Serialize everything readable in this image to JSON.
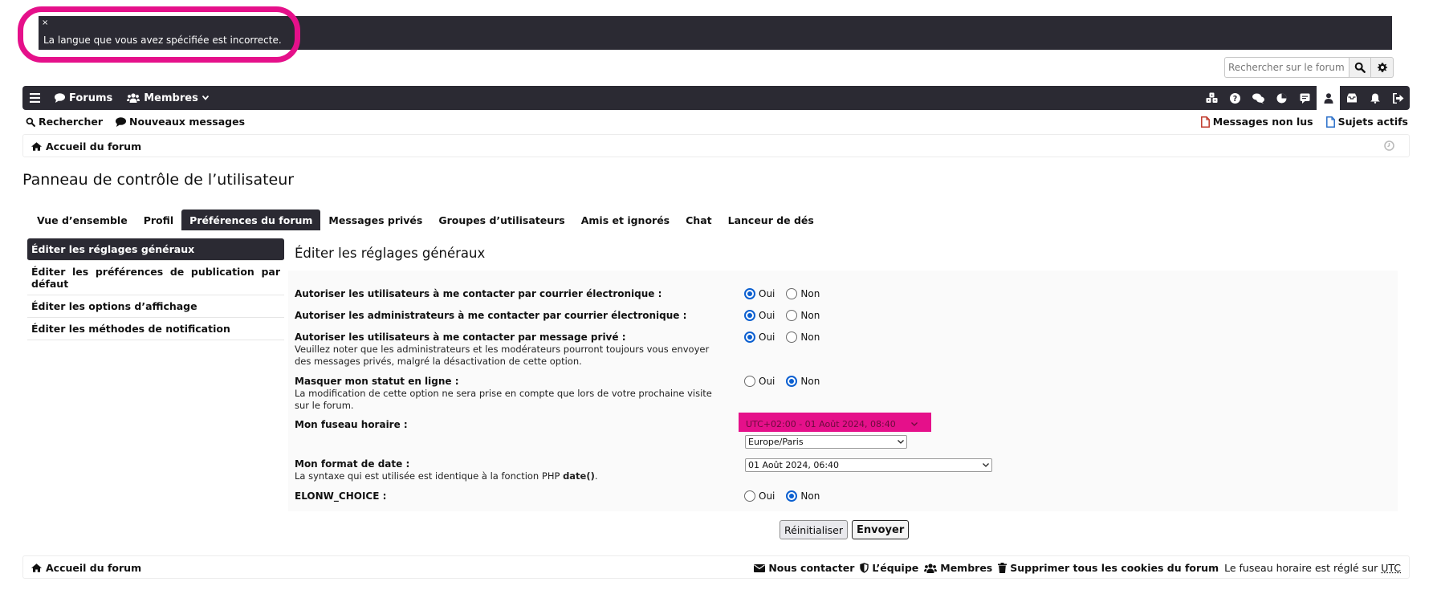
{
  "error_banner": {
    "close": "×",
    "message": "La langue que vous avez spécifiée est incorrecte."
  },
  "search": {
    "placeholder": "Rechercher sur le forum"
  },
  "navbar": {
    "forums": "Forums",
    "members": "Membres"
  },
  "subnav": {
    "search": "Rechercher",
    "new_posts": "Nouveaux messages",
    "unread": "Messages non lus",
    "active_topics": "Sujets actifs"
  },
  "breadcrumb": {
    "home": "Accueil du forum"
  },
  "page_title": "Panneau de contrôle de l’utilisateur",
  "tabs": [
    {
      "label": "Vue d’ensemble"
    },
    {
      "label": "Profil"
    },
    {
      "label": "Préférences du forum"
    },
    {
      "label": "Messages privés"
    },
    {
      "label": "Groupes d’utilisateurs"
    },
    {
      "label": "Amis et ignorés"
    },
    {
      "label": "Chat"
    },
    {
      "label": "Lanceur de dés"
    }
  ],
  "sidebar": [
    {
      "label": "Éditer les réglages généraux"
    },
    {
      "label": "Éditer les préférences de publication par défaut"
    },
    {
      "label": "Éditer les options d’affichage"
    },
    {
      "label": "Éditer les méthodes de notification"
    }
  ],
  "panel": {
    "title": "Éditer les réglages généraux",
    "yes": "Oui",
    "no": "Non",
    "rows": [
      {
        "label": "Autoriser les utilisateurs à me contacter par courrier électronique :",
        "desc": "",
        "value": "Oui"
      },
      {
        "label": "Autoriser les administrateurs à me contacter par courrier électronique :",
        "desc": "",
        "value": "Oui"
      },
      {
        "label": "Autoriser les utilisateurs à me contacter par message privé :",
        "desc": "Veuillez noter que les administrateurs et les modérateurs pourront toujours vous envoyer des messages privés, malgré la désactivation de cette option.",
        "value": "Oui"
      },
      {
        "label": "Masquer mon statut en ligne :",
        "desc": "La modification de cette option ne sera prise en compte que lors de votre prochaine visite sur le forum.",
        "value": "Non"
      },
      {
        "label": "Mon fuseau horaire :",
        "desc": ""
      },
      {
        "label": "Mon format de date :",
        "desc_prefix": "La syntaxe qui est utilisée est identique à la fonction PHP ",
        "desc_code": "date()",
        "desc_suffix": "."
      },
      {
        "label": "ELONW_CHOICE :",
        "desc": "",
        "value": "Non"
      }
    ],
    "timezone_offset": "UTC+02:00 - 01 Août 2024, 08:40",
    "timezone": "Europe/Paris",
    "date_format": "01 Août 2024, 06:40",
    "reset": "Réinitialiser",
    "submit": "Envoyer"
  },
  "footer": {
    "home": "Accueil du forum",
    "contact": "Nous contacter",
    "team": "L’équipe",
    "members": "Membres",
    "delete_cookies": "Supprimer tous les cookies du forum",
    "tz_prefix": "Le fuseau horaire est réglé sur ",
    "tz_abbr": "UTC"
  },
  "colors": {
    "dark": "#2b2a33",
    "highlight": "#e5108a",
    "radio_accent": "#0b5fd0",
    "page_icon_red": "#c0392b",
    "page_icon_blue": "#2a6fc9"
  },
  "icons": {
    "navbar_left": [
      "bars-icon",
      "comment-icon",
      "users-icon",
      "caret-down-icon"
    ],
    "navbar_right": [
      "cubes-icon",
      "question-icon",
      "comments-icon",
      "pie-chart-icon",
      "chat-box-icon",
      "user-icon",
      "inbox-icon",
      "bell-icon",
      "sign-out-icon"
    ],
    "search": [
      "search-icon",
      "gear-icon"
    ],
    "subnav": [
      "search-icon",
      "comment-icon",
      "file-red-icon",
      "file-blue-icon"
    ],
    "breadcrumb": [
      "home-icon",
      "clock-icon"
    ],
    "footer": [
      "home-icon",
      "envelope-icon",
      "shield-icon",
      "users-icon",
      "trash-icon"
    ]
  }
}
